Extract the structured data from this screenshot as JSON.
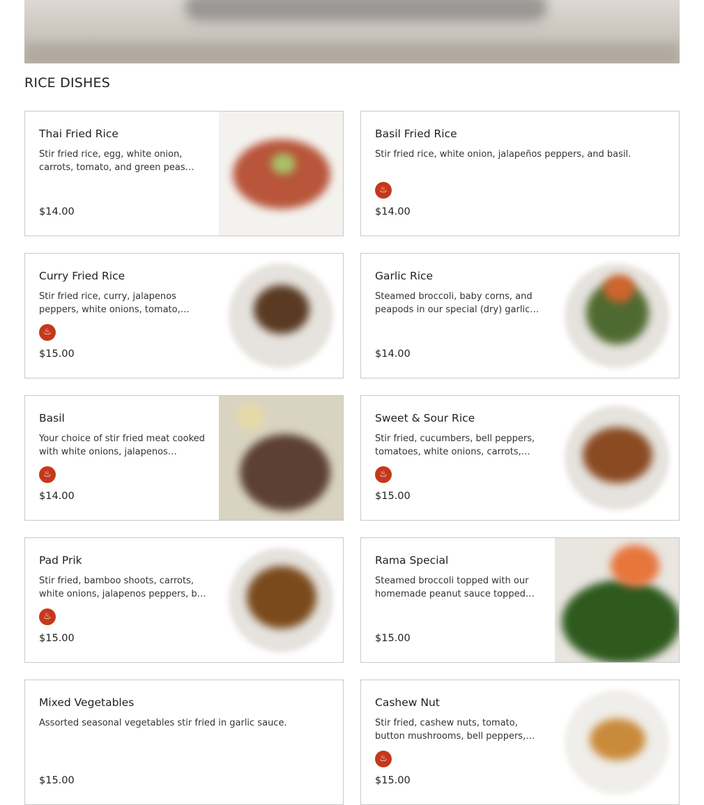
{
  "section": {
    "title": "RICE DISHES"
  },
  "colors": {
    "spicy_badge": "#c5381c",
    "border": "#c8c8c8"
  },
  "items": [
    {
      "name": "Thai Fried Rice",
      "description": "Stir fried rice, egg, white onion, carrots, tomato, and green peas…",
      "price": "$14.00",
      "spicy": false,
      "has_photo": true,
      "spicy_icon": "chili-pepper-icon"
    },
    {
      "name": "Basil Fried Rice",
      "description": "Stir fried rice, white onion, jalapeños peppers, and basil.",
      "price": "$14.00",
      "spicy": true,
      "has_photo": false,
      "spicy_icon": "chili-pepper-icon"
    },
    {
      "name": "Curry Fried Rice",
      "description": "Stir fried rice, curry, jalapenos peppers, white onions, tomato,…",
      "price": "$15.00",
      "spicy": true,
      "has_photo": true,
      "spicy_icon": "chili-pepper-icon"
    },
    {
      "name": "Garlic Rice",
      "description": "Steamed broccoli, baby corns, and peapods in our special (dry) garlic…",
      "price": "$14.00",
      "spicy": false,
      "has_photo": true,
      "spicy_icon": "chili-pepper-icon"
    },
    {
      "name": "Basil",
      "description": "Your choice of stir fried meat cooked with white onions, jalapenos peppe…",
      "price": "$14.00",
      "spicy": true,
      "has_photo": true,
      "spicy_icon": "chili-pepper-icon"
    },
    {
      "name": "Sweet & Sour Rice",
      "description": "Stir fried, cucumbers, bell peppers, tomatoes, white onions, carrots, an…",
      "price": "$15.00",
      "spicy": true,
      "has_photo": true,
      "spicy_icon": "chili-pepper-icon"
    },
    {
      "name": "Pad Prik",
      "description": "Stir fried, bamboo shoots, carrots, white onions, jalapenos peppers, b…",
      "price": "$15.00",
      "spicy": true,
      "has_photo": true,
      "spicy_icon": "chili-pepper-icon"
    },
    {
      "name": "Rama Special",
      "description": "Steamed broccoli topped with our homemade peanut sauce topped w…",
      "price": "$15.00",
      "spicy": false,
      "has_photo": true,
      "spicy_icon": "chili-pepper-icon"
    },
    {
      "name": "Mixed Vegetables",
      "description": "Assorted seasonal vegetables stir fried in garlic sauce.",
      "price": "$15.00",
      "spicy": false,
      "has_photo": false,
      "spicy_icon": "chili-pepper-icon"
    },
    {
      "name": "Cashew Nut",
      "description": "Stir fried, cashew nuts, tomato, button mushrooms, bell peppers, pea pod…",
      "price": "$15.00",
      "spicy": true,
      "has_photo": true,
      "spicy_icon": "chili-pepper-icon"
    }
  ]
}
